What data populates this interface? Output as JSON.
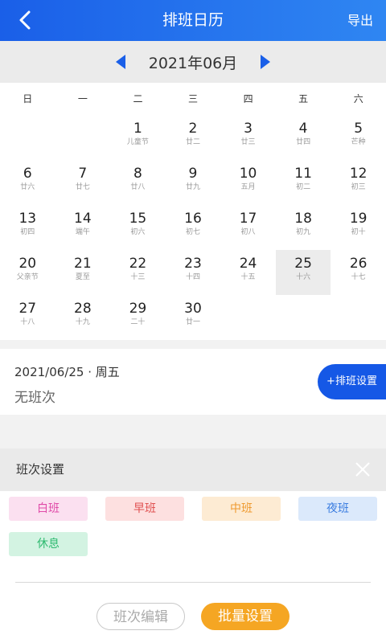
{
  "header": {
    "title": "排班日历",
    "export_label": "导出"
  },
  "month_bar": {
    "label": "2021年06月"
  },
  "weekdays": [
    "日",
    "一",
    "二",
    "三",
    "四",
    "五",
    "六"
  ],
  "calendar": {
    "leading_empty": 2,
    "selected_day": "25",
    "days": [
      {
        "day": "1",
        "lunar": "儿童节"
      },
      {
        "day": "2",
        "lunar": "廿二"
      },
      {
        "day": "3",
        "lunar": "廿三"
      },
      {
        "day": "4",
        "lunar": "廿四"
      },
      {
        "day": "5",
        "lunar": "芒种"
      },
      {
        "day": "6",
        "lunar": "廿六"
      },
      {
        "day": "7",
        "lunar": "廿七"
      },
      {
        "day": "8",
        "lunar": "廿八"
      },
      {
        "day": "9",
        "lunar": "廿九"
      },
      {
        "day": "10",
        "lunar": "五月"
      },
      {
        "day": "11",
        "lunar": "初二"
      },
      {
        "day": "12",
        "lunar": "初三"
      },
      {
        "day": "13",
        "lunar": "初四"
      },
      {
        "day": "14",
        "lunar": "端午"
      },
      {
        "day": "15",
        "lunar": "初六"
      },
      {
        "day": "16",
        "lunar": "初七"
      },
      {
        "day": "17",
        "lunar": "初八"
      },
      {
        "day": "18",
        "lunar": "初九"
      },
      {
        "day": "19",
        "lunar": "初十"
      },
      {
        "day": "20",
        "lunar": "父亲节"
      },
      {
        "day": "21",
        "lunar": "夏至"
      },
      {
        "day": "22",
        "lunar": "十三"
      },
      {
        "day": "23",
        "lunar": "十四"
      },
      {
        "day": "24",
        "lunar": "十五"
      },
      {
        "day": "25",
        "lunar": "十六"
      },
      {
        "day": "26",
        "lunar": "十七"
      },
      {
        "day": "27",
        "lunar": "十八"
      },
      {
        "day": "28",
        "lunar": "十九"
      },
      {
        "day": "29",
        "lunar": "二十"
      },
      {
        "day": "30",
        "lunar": "廿一"
      }
    ]
  },
  "day_info": {
    "date_line": "2021/06/25 · 周五",
    "status": "无班次",
    "add_button": "+排班设置"
  },
  "panel": {
    "title": "班次设置",
    "shifts": [
      {
        "label": "白班",
        "bg": "#fbe0f0",
        "fg": "#e04aa8"
      },
      {
        "label": "早班",
        "bg": "#fde0e0",
        "fg": "#e05050"
      },
      {
        "label": "中班",
        "bg": "#fdebd3",
        "fg": "#ee9a30"
      },
      {
        "label": "夜班",
        "bg": "#dbe9fb",
        "fg": "#3b7de0"
      },
      {
        "label": "休息",
        "bg": "#d3f3e2",
        "fg": "#2fba70"
      }
    ],
    "edit_button": "班次编辑",
    "batch_button": "批量设置"
  },
  "colors": {
    "accent": "#1558e6",
    "orange": "#f5a623"
  }
}
